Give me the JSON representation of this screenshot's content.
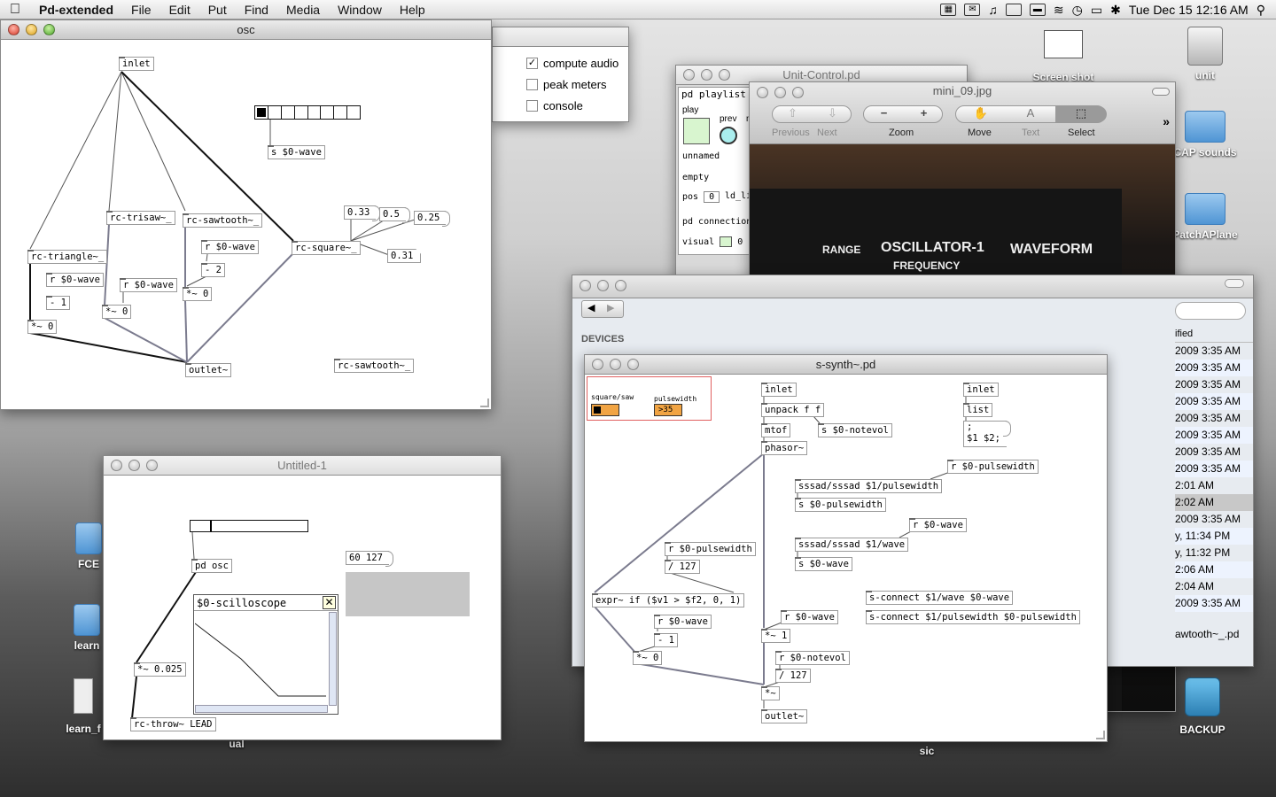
{
  "menubar": {
    "app": "Pd-extended",
    "items": [
      "File",
      "Edit",
      "Put",
      "Find",
      "Media",
      "Window",
      "Help"
    ],
    "clock": "Tue Dec 15  12:16 AM"
  },
  "desktop": {
    "icons": [
      "unit",
      "Screen shot",
      "CAP sounds",
      "PatchAPlane",
      "BACKUP",
      "FCE",
      "learn",
      "learn_f",
      "ual",
      "sic"
    ]
  },
  "pd_main": {
    "compute_audio": "compute audio",
    "peak_meters": "peak meters",
    "console": "console"
  },
  "osc": {
    "title": "osc",
    "inlet": "inlet",
    "s_wave": "s $0-wave",
    "rc_trisaw": "rc-trisaw~_",
    "rc_sawtooth": "rc-sawtooth~_",
    "rc_triangle": "rc-triangle~_",
    "rc_square": "rc-square~_",
    "r_wave": "r $0-wave",
    "minus2": "- 2",
    "minus1": "- 1",
    "mul0": "*~ 0",
    "outlet": "outlet~",
    "rc_sawtooth2": "rc-sawtooth~_",
    "v033": "0.33",
    "v05": "0.5",
    "v025": "0.25",
    "v031": "0.31"
  },
  "untitled": {
    "title": "Untitled-1",
    "pd_osc": "pd osc",
    "scope": "$0-scilloscope",
    "mul": "*~ 0.025",
    "throw": "rc-throw~ LEAD",
    "msg": "60 127"
  },
  "unit": {
    "title": "Unit-Control.pd",
    "playlist": "pd playlist",
    "play": "play",
    "prev": "prev",
    "next": "ne",
    "unnamed": "unnamed",
    "empty": "empty",
    "pos": "pos",
    "pos_val": "0",
    "ld": "ld_li",
    "connection": "pd connection",
    "visual": "visual",
    "visual_val": "0"
  },
  "preview": {
    "title": "mini_09.jpg",
    "previous": "Previous",
    "next": "Next",
    "zoom": "Zoom",
    "move": "Move",
    "text": "Text",
    "select": "Select",
    "photo_range": "RANGE",
    "photo_osc": "OSCILLATOR-1",
    "photo_freq": "FREQUENCY",
    "photo_wave": "WAVEFORM"
  },
  "finder": {
    "devices": "DEVICES",
    "col": "ified",
    "rows": [
      "2009 3:35 AM",
      "2009 3:35 AM",
      "2009 3:35 AM",
      "2009 3:35 AM",
      "2009 3:35 AM",
      "2009 3:35 AM",
      "2009 3:35 AM",
      "2009 3:35 AM",
      "2:01 AM",
      "2:02 AM",
      "2009 3:35 AM",
      "y, 11:34 PM",
      "y, 11:32 PM",
      "2:06 AM",
      "2:04 AM",
      "2009 3:35 AM"
    ],
    "footer": "awtooth~_.pd"
  },
  "ssynth": {
    "title": "s-synth~.pd",
    "sq_label": "square/saw",
    "pw_label": "pulsewidth",
    "pw_val": "35",
    "inlet": "inlet",
    "unpack": "unpack f f",
    "s_notevol": "s $0-notevol",
    "mtof": "mtof",
    "phasor": "phasor~",
    "inlet2": "inlet",
    "list": "list",
    "msg_semi": ";",
    "msg_args": "$1 $2;",
    "r_pw": "r $0-pulsewidth",
    "sssad_pw": "sssad/sssad $1/pulsewidth",
    "s_pw": "s $0-pulsewidth",
    "r_wave": "r $0-wave",
    "sssad_wave": "sssad/sssad $1/wave",
    "s_wave": "s $0-wave",
    "r_pw2": "r $0-pulsewidth",
    "div127": "/ 127",
    "expr": "expr~ if ($v1 > $f2, 0, 1)",
    "r_wave2": "r $0-wave",
    "minus1": "- 1",
    "mul0": "*~ 0",
    "r_wave3": "r $0-wave",
    "mul1": "*~ 1",
    "r_notevol": "r $0-notevol",
    "div127b": "/ 127",
    "mulx": "*~",
    "outlet": "outlet~",
    "sc1": "s-connect $1/wave $0-wave",
    "sc2": "s-connect $1/pulsewidth $0-pulsewidth"
  }
}
